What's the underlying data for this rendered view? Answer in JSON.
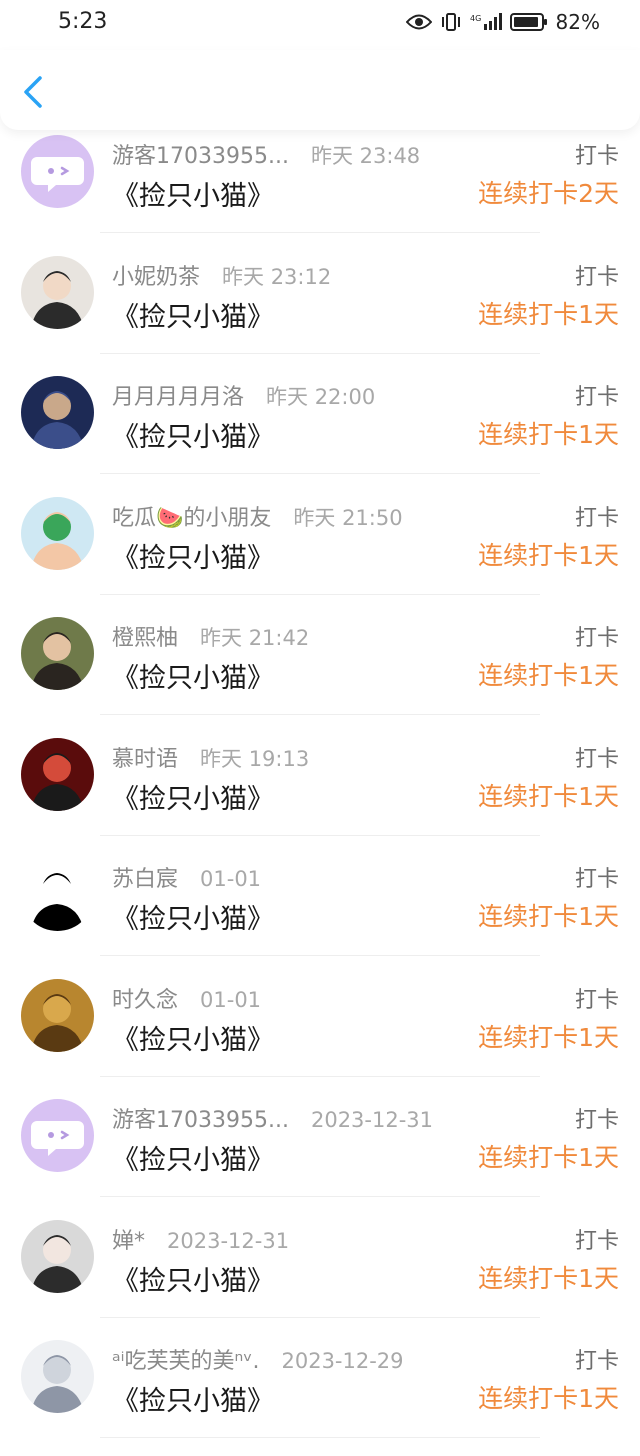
{
  "status_bar": {
    "time": "5:23",
    "battery": "82%",
    "icons": [
      "eye-icon",
      "vibrate-icon",
      "signal-4g-icon",
      "battery-icon"
    ]
  },
  "nav": {
    "back_icon": "chevron-left-icon",
    "accent": "#2aa3f5"
  },
  "colors": {
    "streak": "#f08a3c",
    "name": "#8a8a8a"
  },
  "list": {
    "items": [
      {
        "name": "游客17033955...",
        "time": "昨天 23:48",
        "title": "《捡只小猫》",
        "action": "打卡",
        "streak": "连续打卡2天",
        "avatar": "guest-avatar-icon"
      },
      {
        "name": "小妮奶茶",
        "time": "昨天 23:12",
        "title": "《捡只小猫》",
        "action": "打卡",
        "streak": "连续打卡1天",
        "avatar": "user-photo"
      },
      {
        "name": "月月月月月洛",
        "time": "昨天 22:00",
        "title": "《捡只小猫》",
        "action": "打卡",
        "streak": "连续打卡1天",
        "avatar": "user-photo"
      },
      {
        "name": "吃瓜🍉的小朋友",
        "time": "昨天 21:50",
        "title": "《捡只小猫》",
        "action": "打卡",
        "streak": "连续打卡1天",
        "avatar": "user-photo"
      },
      {
        "name": "橙熙柚",
        "time": "昨天 21:42",
        "title": "《捡只小猫》",
        "action": "打卡",
        "streak": "连续打卡1天",
        "avatar": "user-photo"
      },
      {
        "name": "慕时语",
        "time": "昨天 19:13",
        "title": "《捡只小猫》",
        "action": "打卡",
        "streak": "连续打卡1天",
        "avatar": "user-photo"
      },
      {
        "name": "苏白宸",
        "time": "01-01",
        "title": "《捡只小猫》",
        "action": "打卡",
        "streak": "连续打卡1天",
        "avatar": "user-photo"
      },
      {
        "name": "时久念",
        "time": "01-01",
        "title": "《捡只小猫》",
        "action": "打卡",
        "streak": "连续打卡1天",
        "avatar": "user-photo"
      },
      {
        "name": "游客17033955...",
        "time": "2023-12-31",
        "title": "《捡只小猫》",
        "action": "打卡",
        "streak": "连续打卡1天",
        "avatar": "guest-avatar-icon"
      },
      {
        "name": "婵*",
        "time": "2023-12-31",
        "title": "《捡只小猫》",
        "action": "打卡",
        "streak": "连续打卡1天",
        "avatar": "user-photo"
      },
      {
        "name": "ᵃⁱ吃芙芙的美ⁿᵛ.",
        "time": "2023-12-29",
        "title": "《捡只小猫》",
        "action": "打卡",
        "streak": "连续打卡1天",
        "avatar": "user-photo"
      }
    ]
  }
}
